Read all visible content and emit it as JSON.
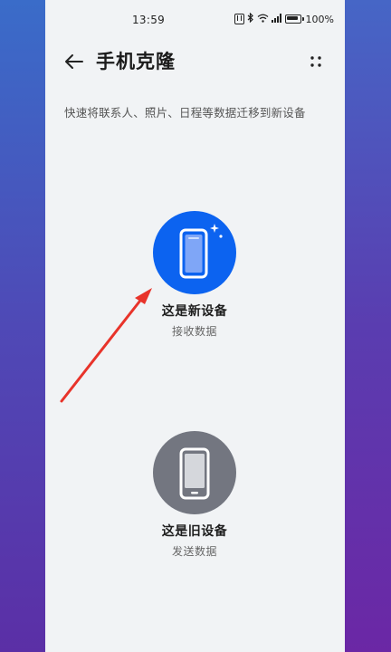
{
  "status_bar": {
    "time": "13:59",
    "battery": "100%"
  },
  "header": {
    "title": "手机克隆"
  },
  "subtitle": "快速将联系人、照片、日程等数据迁移到新设备",
  "options": {
    "new_device": {
      "label": "这是新设备",
      "sub": "接收数据",
      "color": "#0c63f0"
    },
    "old_device": {
      "label": "这是旧设备",
      "sub": "发送数据",
      "color": "#737680"
    }
  },
  "annotation": {
    "arrow_color": "#e8332a"
  }
}
